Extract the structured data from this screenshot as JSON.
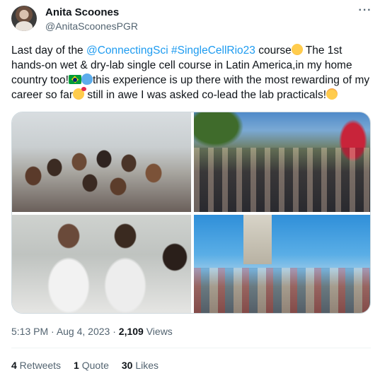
{
  "author": {
    "name": "Anita Scoones",
    "handle": "@AnitaScoonesPGR"
  },
  "menu": {
    "more_label": "···"
  },
  "tweet": {
    "seg1": "Last day of the ",
    "mention": "@ConnectingSci",
    "seg2": " ",
    "hashtag": "#SingleCellRio23",
    "seg3": " course",
    "seg4": " The 1st hands-on wet & dry-lab single cell course in Latin America,in my home country too!",
    "seg5": "this experience is up there with the most rewarding of my career so far",
    "seg6": " still in awe I was asked co-lead the lab practicals!",
    "emojis": [
      "pleading-face",
      "brazil-flag",
      "blue-heart",
      "smiling-face-with-hearts",
      "exploding-head"
    ]
  },
  "media": {
    "photos": [
      "lab-group-photo",
      "outdoor-steps-group-photo",
      "lab-practical-photo",
      "christ-the-redeemer-group-photo"
    ]
  },
  "meta": {
    "time": "5:13 PM",
    "sep": " · ",
    "date": "Aug 4, 2023",
    "sep2": " · ",
    "views_count": "2,109",
    "views_label": " Views"
  },
  "stats": {
    "retweets_count": "4",
    "retweets_label": " Retweets",
    "quotes_count": "1",
    "quotes_label": " Quote",
    "likes_count": "30",
    "likes_label": " Likes"
  }
}
